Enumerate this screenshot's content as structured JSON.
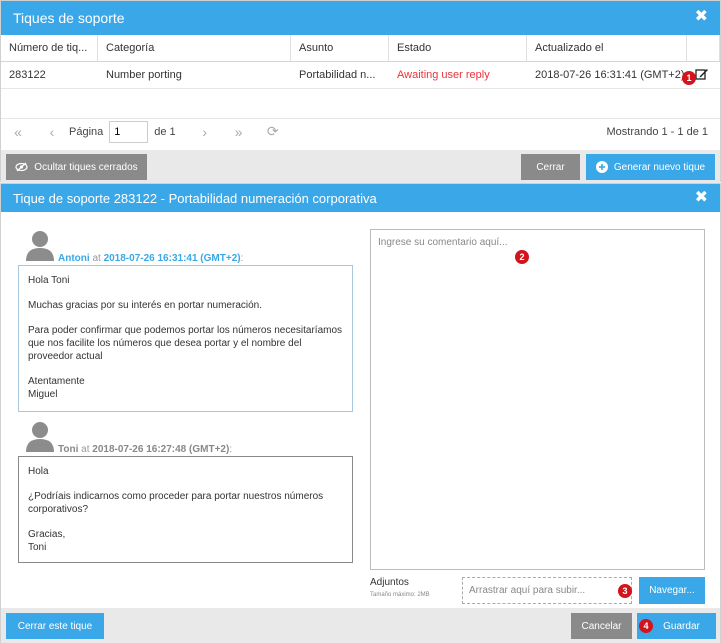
{
  "list_window": {
    "title": "Tiques de soporte",
    "close_glyph": "✖",
    "columns": [
      "Número de tiq...",
      "Categoría",
      "Asunto",
      "Estado",
      "Actualizado el",
      ""
    ],
    "rows": [
      {
        "number": "283122",
        "category": "Number porting",
        "subject": "Portabilidad n...",
        "status": "Awaiting user reply",
        "updated": "2018-07-26 16:31:41 (GMT+2)"
      }
    ],
    "pager": {
      "page_label": "Página",
      "page_value": "1",
      "of_label": "de 1",
      "showing": "Mostrando 1 - 1 de 1"
    },
    "buttons": {
      "hide_closed": "Ocultar tiques cerrados",
      "close": "Cerrar",
      "new_ticket": "Generar nuevo tique"
    }
  },
  "detail_window": {
    "title": "Tique de soporte 283122 - Portabilidad numeración corporativa",
    "close_glyph": "✖",
    "messages": [
      {
        "author": "Antoni",
        "at": "at",
        "datetime": "2018-07-26 16:31:41 (GMT+2)",
        "colon": ":",
        "paragraphs": [
          "Hola Toni",
          "Muchas gracias por su interés en portar numeración.",
          "Para poder confirmar que podemos portar los números necesitaríamos que nos facilite los números que desea portar y el nombre del proveedor actual",
          "Atentamente\nMiguel"
        ]
      },
      {
        "author": "Toni",
        "at": "at",
        "datetime": "2018-07-26 16:27:48 (GMT+2)",
        "colon": ":",
        "paragraphs": [
          "Hola",
          "¿Podríais indicarnos como proceder para portar nuestros números corporativos?",
          "Gracias,\nToni"
        ]
      }
    ],
    "comment_placeholder": "Ingrese su comentario aquí...",
    "attachments_label": "Adjuntos",
    "max_size": "Tamaño máximo: 2MB",
    "drop_placeholder": "Arrastrar aquí para subir...",
    "buttons": {
      "browse": "Navegar...",
      "close_ticket": "Cerrar este tique",
      "cancel": "Cancelar",
      "save": "Guardar"
    }
  },
  "badges": [
    "1",
    "2",
    "3",
    "4"
  ],
  "colors": {
    "accent": "#3aa8e8",
    "status_red": "#e8333a",
    "badge": "#d4141c"
  }
}
